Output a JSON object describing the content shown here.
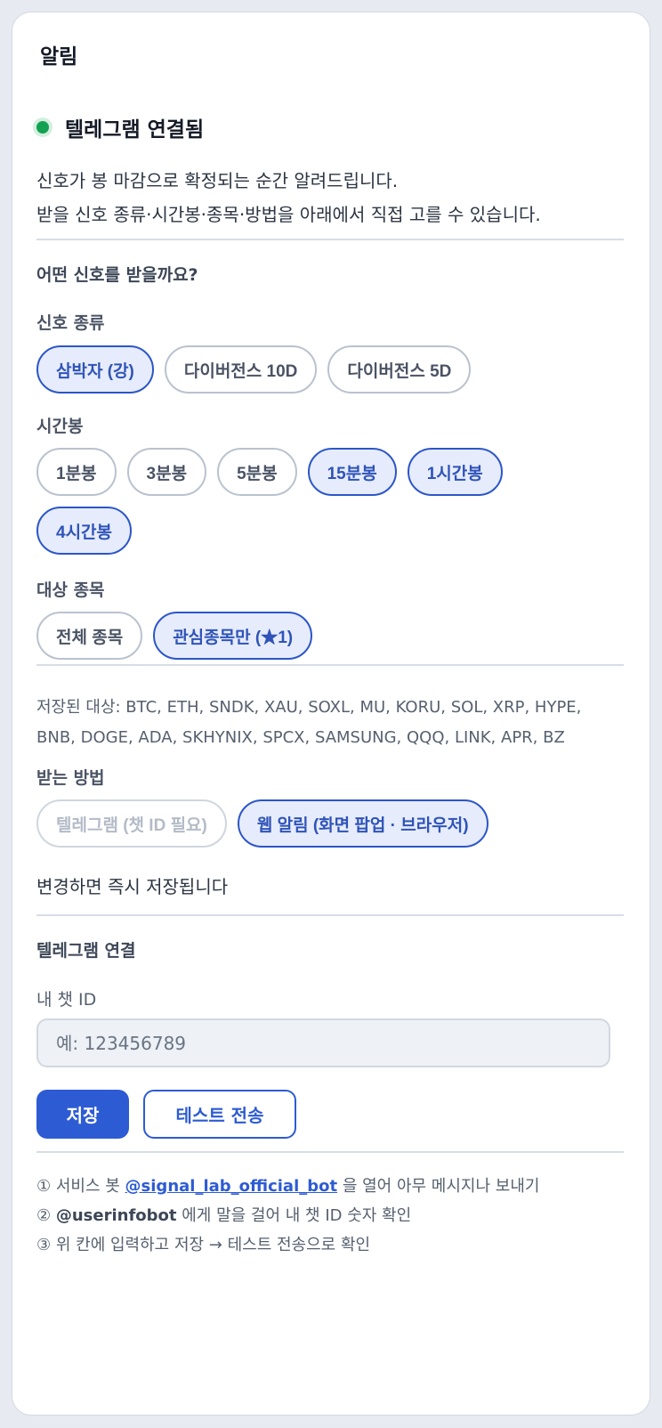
{
  "header": {
    "title": "알림"
  },
  "status": {
    "text": "텔레그램 연결됨",
    "color": "#12a150"
  },
  "description": {
    "line1": "신호가 봉 마감으로 확정되는 순간 알려드립니다.",
    "line2": "받을 신호 종류·시간봉·종목·방법을 아래에서 직접 고를 수 있습니다."
  },
  "preferences": {
    "heading": "어떤 신호를 받을까요?",
    "signal_types": {
      "label": "신호 종류",
      "options": [
        {
          "label": "삼박자 (강)",
          "selected": true
        },
        {
          "label": "다이버전스 10D",
          "selected": false
        },
        {
          "label": "다이버전스 5D",
          "selected": false
        }
      ]
    },
    "timeframes": {
      "label": "시간봉",
      "options": [
        {
          "label": "1분봉",
          "selected": false
        },
        {
          "label": "3분봉",
          "selected": false
        },
        {
          "label": "5분봉",
          "selected": false
        },
        {
          "label": "15분봉",
          "selected": true
        },
        {
          "label": "1시간봉",
          "selected": true
        },
        {
          "label": "4시간봉",
          "selected": true
        }
      ]
    },
    "targets": {
      "label": "대상 종목",
      "options": [
        {
          "label": "전체 종목",
          "selected": false
        },
        {
          "label": "관심종목만 (★1)",
          "selected": true
        }
      ],
      "saved_text": "저장된 대상: BTC, ETH, SNDK, XAU, SOXL, MU, KORU, SOL, XRP, HYPE, BNB, DOGE, ADA, SKHYNIX, SPCX, SAMSUNG, QQQ, LINK, APR, BZ"
    },
    "methods": {
      "label": "받는 방법",
      "options": [
        {
          "label": "텔레그램 (챗 ID 필요)",
          "selected": false,
          "disabled": true
        },
        {
          "label": "웹 알림 (화면 팝업 · 브라우저)",
          "selected": true
        }
      ]
    },
    "autosave_note": "변경하면 즉시 저장됩니다"
  },
  "telegram": {
    "heading": "텔레그램 연결",
    "chat_id_label": "내 챗 ID",
    "chat_id_placeholder": "예: 123456789",
    "chat_id_value": "",
    "save_label": "저장",
    "test_label": "테스트 전송",
    "steps": {
      "s1_prefix": "① 서비스 봇 ",
      "s1_link": "@signal_lab_official_bot",
      "s1_suffix": " 을 열어 아무 메시지나 보내기",
      "s2_prefix": "② ",
      "s2_bold": "@userinfobot",
      "s2_suffix": " 에게 말을 걸어 내 챗 ID 숫자 확인",
      "s3": "③ 위 칸에 입력하고 저장 → 테스트 전송으로 확인"
    }
  },
  "colors": {
    "accent": "#2d5bd3",
    "chip_selected_bg": "#e6ecfb",
    "online": "#12a150"
  }
}
